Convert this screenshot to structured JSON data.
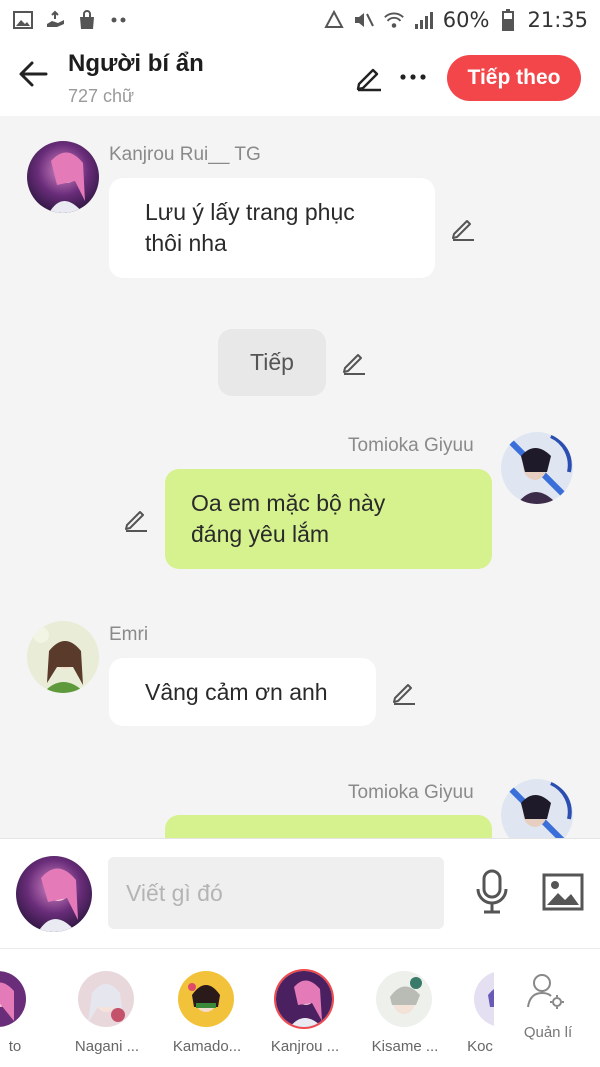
{
  "status_bar": {
    "battery": "60%",
    "time": "21:35"
  },
  "header": {
    "title": "Người bí ẩn",
    "word_count": "727 chữ",
    "next_label": "Tiếp theo"
  },
  "messages": [
    {
      "speaker": "Kanjrou Rui__ TG",
      "side": "left",
      "text": "Lưu ý lấy trang phục\nthôi nha"
    },
    {
      "speaker": "",
      "side": "center",
      "text": "Tiếp"
    },
    {
      "speaker": "Tomioka Giyuu",
      "side": "right",
      "text": "Oa em mặc bộ này\nđáng yêu lắm"
    },
    {
      "speaker": "Emri",
      "side": "left",
      "text": "Vâng cảm ơn anh"
    },
    {
      "speaker": "Tomioka Giyuu",
      "side": "right",
      "text": ""
    }
  ],
  "input": {
    "placeholder": "Viết gì đó"
  },
  "characters": [
    {
      "label": "to",
      "selected": false
    },
    {
      "label": "Nagani ...",
      "selected": false
    },
    {
      "label": "Kamado...",
      "selected": false
    },
    {
      "label": "Kanjrou ...",
      "selected": true
    },
    {
      "label": "Kisame ...",
      "selected": false
    },
    {
      "label": "Koc",
      "selected": false
    }
  ],
  "manage_label": "Quản lí",
  "colors": {
    "accent": "#f2464a",
    "my_bubble": "#d6f28e",
    "other_bubble": "#ffffff"
  }
}
